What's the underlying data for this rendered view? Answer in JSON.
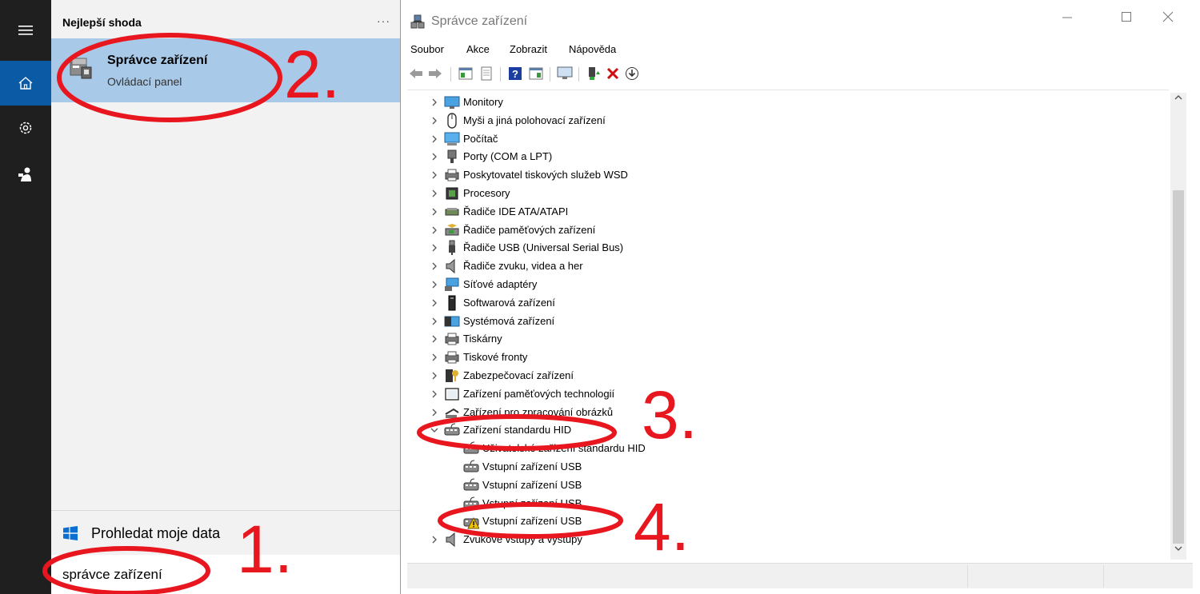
{
  "search_panel": {
    "best_match_header": "Nejlepší shoda",
    "more_glyph": "···",
    "result": {
      "title": "Správce zařízení",
      "subtitle": "Ovládací panel"
    },
    "search_my_data": "Prohledat moje data",
    "search_query": "správce zařízení"
  },
  "rail": {
    "icons": [
      "hamburger-menu-icon",
      "home-icon",
      "settings-gear-icon",
      "user-icon"
    ],
    "accent": "#0a5aa6"
  },
  "device_manager": {
    "title": "Správce zařízení",
    "menu": [
      "Soubor",
      "Akce",
      "Zobrazit",
      "Nápověda"
    ],
    "toolbar_icons": [
      "back-arrow-icon",
      "forward-arrow-icon",
      "properties-grid-icon",
      "page-icon",
      "help-icon",
      "view-icon",
      "monitor-icon",
      "update-driver-icon",
      "uninstall-x-icon",
      "install-arrow-icon"
    ],
    "tree": [
      {
        "label": "Monitory",
        "icon": "monitor-icon",
        "level": 0
      },
      {
        "label": "Myši a jiná polohovací zařízení",
        "icon": "mouse-icon",
        "level": 0
      },
      {
        "label": "Počítač",
        "icon": "computer-icon",
        "level": 0
      },
      {
        "label": "Porty (COM a LPT)",
        "icon": "port-icon",
        "level": 0
      },
      {
        "label": "Poskytovatel tiskových služeb WSD",
        "icon": "printer-icon",
        "level": 0
      },
      {
        "label": "Procesory",
        "icon": "processor-icon",
        "level": 0
      },
      {
        "label": "Řadiče IDE ATA/ATAPI",
        "icon": "ide-icon",
        "level": 0
      },
      {
        "label": "Řadiče paměťových zařízení",
        "icon": "storage-controller-icon",
        "level": 0
      },
      {
        "label": "Řadiče USB (Universal Serial Bus)",
        "icon": "usb-icon",
        "level": 0
      },
      {
        "label": "Řadiče zvuku, videa a her",
        "icon": "speaker-icon",
        "level": 0
      },
      {
        "label": "Síťové adaptéry",
        "icon": "network-icon",
        "level": 0
      },
      {
        "label": "Softwarová zařízení",
        "icon": "software-device-icon",
        "level": 0
      },
      {
        "label": "Systémová zařízení",
        "icon": "system-device-icon",
        "level": 0
      },
      {
        "label": "Tiskárny",
        "icon": "printer-icon",
        "level": 0
      },
      {
        "label": "Tiskové fronty",
        "icon": "printer-icon",
        "level": 0
      },
      {
        "label": "Zabezpečovací zařízení",
        "icon": "security-key-icon",
        "level": 0
      },
      {
        "label": "Zařízení paměťových technologií",
        "icon": "memory-device-icon",
        "level": 0
      },
      {
        "label": "Zařízení pro zpracování obrázků",
        "icon": "imaging-icon",
        "level": 0
      },
      {
        "label": "Zařízení standardu HID",
        "icon": "hid-icon",
        "level": 0,
        "expanded": true
      },
      {
        "label": "Uživatelské zařízení standardu HID",
        "icon": "hid-icon",
        "level": 1
      },
      {
        "label": "Vstupní zařízení USB",
        "icon": "hid-icon",
        "level": 1
      },
      {
        "label": "Vstupní zařízení USB",
        "icon": "hid-icon",
        "level": 1
      },
      {
        "label": "Vstupní zařízení USB",
        "icon": "hid-icon",
        "level": 1
      },
      {
        "label": "Vstupní zařízení USB",
        "icon": "hid-warning-icon",
        "level": 1,
        "warning": true
      },
      {
        "label": "Zvukové vstupy a výstupy",
        "icon": "audio-io-icon",
        "level": 0
      }
    ]
  },
  "annotations": [
    "1.",
    "2.",
    "3.",
    "4."
  ],
  "colors": {
    "annotation_red": "#e8161e",
    "selection": "#a9c9e8",
    "accent": "#0a5aa6"
  }
}
